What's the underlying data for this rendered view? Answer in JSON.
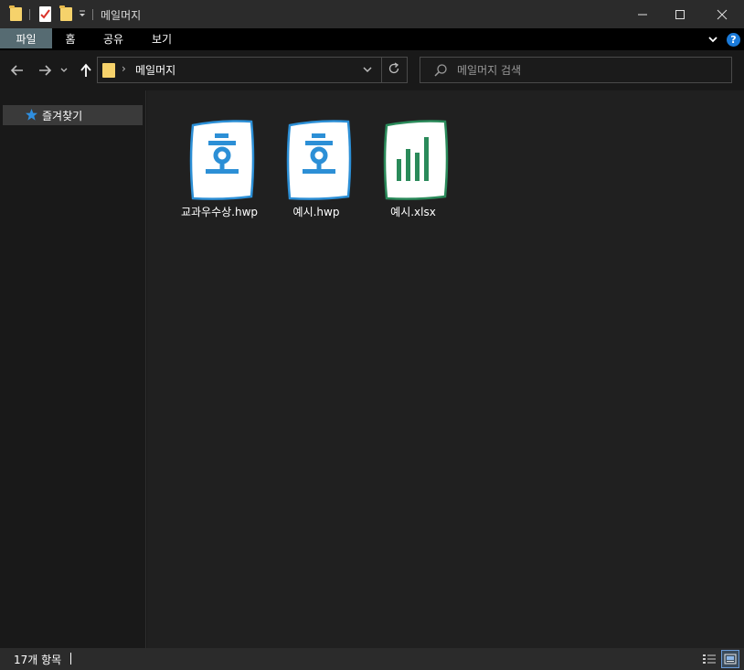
{
  "window": {
    "title": "메일머지"
  },
  "ribbon": {
    "tabs": [
      {
        "label": "파일",
        "active": true
      },
      {
        "label": "홈",
        "active": false
      },
      {
        "label": "공유",
        "active": false
      },
      {
        "label": "보기",
        "active": false
      }
    ],
    "help_label": "?"
  },
  "navigation": {
    "breadcrumb_separator": "›",
    "current_folder": "메일머지",
    "search_placeholder": "메일머지 검색"
  },
  "sidebar": {
    "items": [
      {
        "label": "즐겨찾기",
        "icon": "star-icon"
      }
    ]
  },
  "files": [
    {
      "name": "교과우수상.hwp",
      "type": "hwp"
    },
    {
      "name": "예시.hwp",
      "type": "hwp"
    },
    {
      "name": "예시.xlsx",
      "type": "xlsx"
    }
  ],
  "status": {
    "item_count": "17개 항목"
  },
  "colors": {
    "hwp_accent": "#2c8fd6",
    "xlsx_accent": "#2a8a5a",
    "folder": "#f6d26b",
    "active_tab": "#566b72"
  }
}
